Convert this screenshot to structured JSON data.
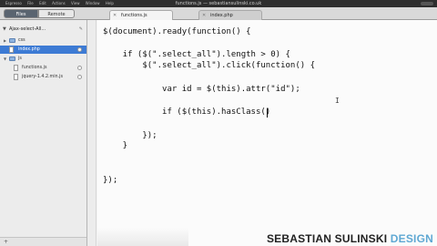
{
  "window": {
    "title": "functions.js — sebastiansulinski.co.uk",
    "menus": [
      "Espresso",
      "File",
      "Edit",
      "Actions",
      "View",
      "Window",
      "Help"
    ]
  },
  "tabs": {
    "files_label": "Files",
    "remote_label": "Remote",
    "editor_tabs": [
      "functions.js",
      "index.php"
    ]
  },
  "sidebar": {
    "project": "Ajax-select-All...",
    "items": [
      {
        "type": "folder",
        "label": "css"
      },
      {
        "type": "file",
        "label": "index.php"
      },
      {
        "type": "folder",
        "label": "js"
      },
      {
        "type": "file",
        "label": "functions.js"
      },
      {
        "type": "file",
        "label": "jquery-1.4.2.min.js"
      }
    ]
  },
  "code_lines": [
    "$(document).ready(function() {",
    "",
    "    if ($(\".select_all\").length > 0) {",
    "        $(\".select_all\").click(function() {",
    "",
    "            var id = $(this).attr(\"id\");",
    "",
    "            if ($(this).hasClass()",
    "",
    "        });",
    "    }",
    "",
    "",
    "});"
  ],
  "watermark": {
    "part1": "SEBASTIAN SULINSKI",
    "part2": "DESIGN"
  }
}
